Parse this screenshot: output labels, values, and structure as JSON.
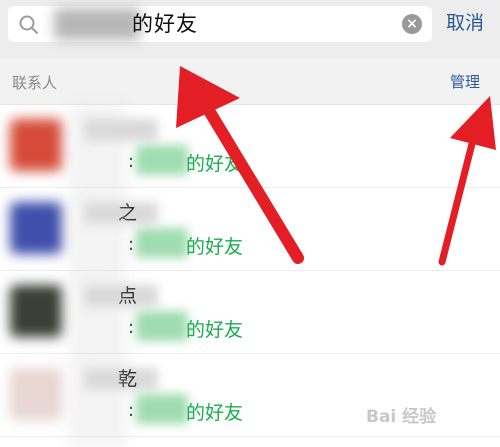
{
  "search": {
    "query_visible_suffix": "的好友",
    "cancel_label": "取消"
  },
  "section": {
    "title": "联系人",
    "manage_label": "管理"
  },
  "contacts": [
    {
      "name_char": "",
      "sub_prefix": ":",
      "sub_suffix": "的好友",
      "avatar_color": "#d64b3a"
    },
    {
      "name_char": "之",
      "sub_prefix": ":",
      "sub_suffix": "的好友",
      "avatar_color": "#3f4faa"
    },
    {
      "name_char": "点",
      "sub_prefix": ":",
      "sub_suffix": "的好友",
      "avatar_color": "#3a3f35"
    },
    {
      "name_char": "乾",
      "sub_prefix": ":",
      "sub_suffix": "的好友",
      "avatar_color": "#e7d6d2"
    }
  ],
  "watermark": "Bai 经验",
  "colors": {
    "link": "#2b5b95",
    "highlight_green": "#1aad4f",
    "annotation_arrow": "#e31e24"
  }
}
